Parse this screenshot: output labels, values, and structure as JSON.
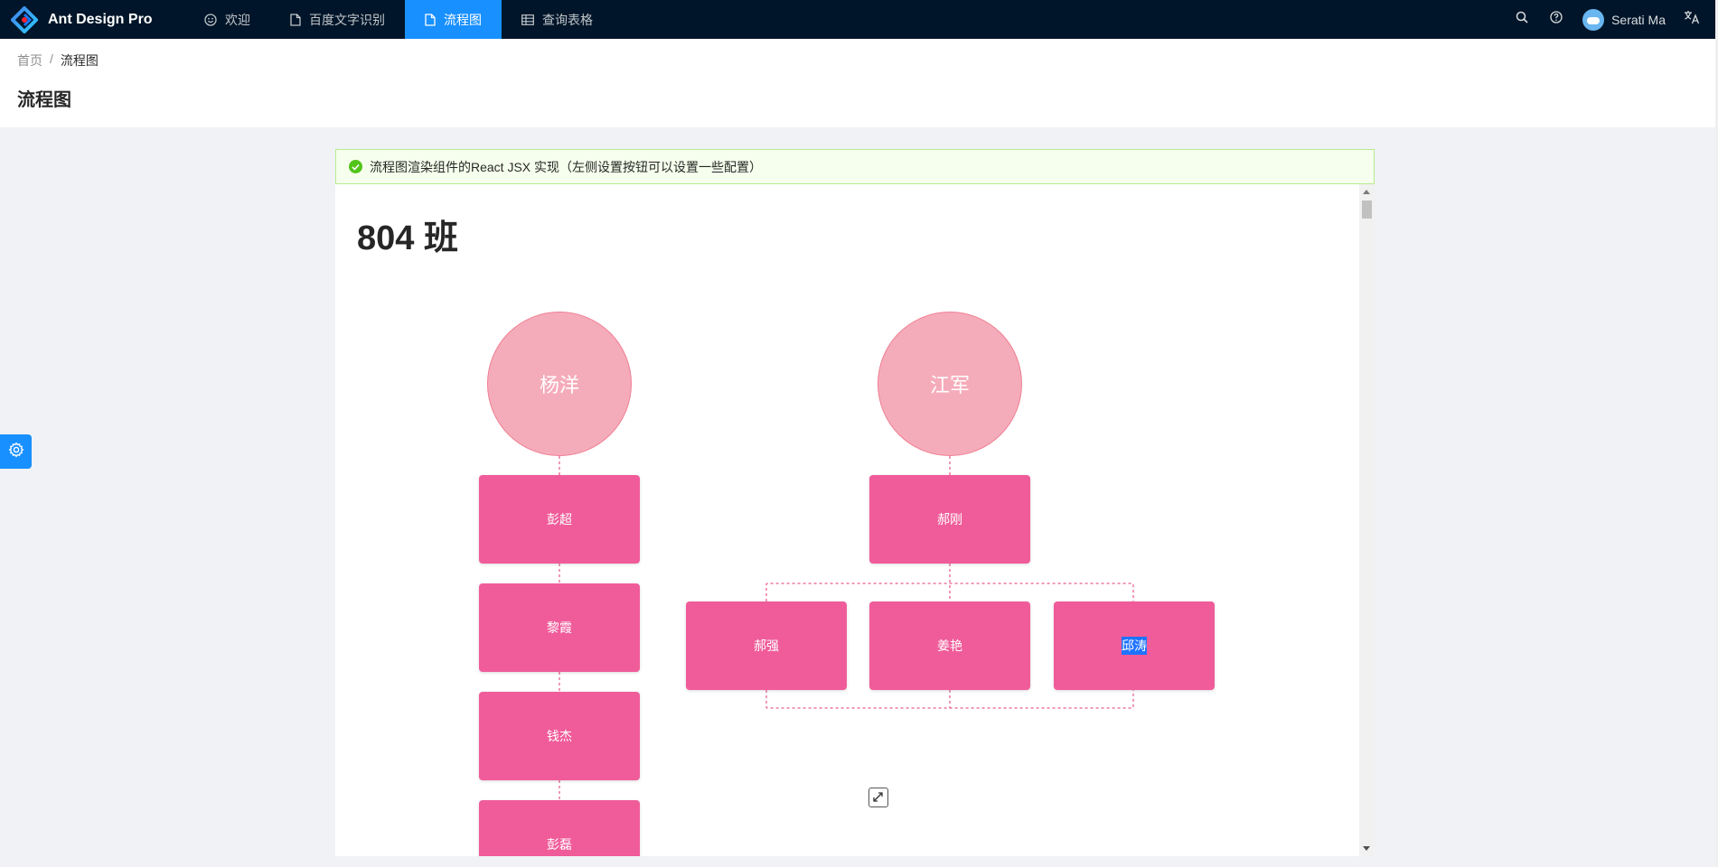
{
  "app": {
    "title": "Ant Design Pro"
  },
  "nav": [
    {
      "label": "欢迎",
      "icon": "smile-icon",
      "active": false
    },
    {
      "label": "百度文字识别",
      "icon": "file-icon",
      "active": false
    },
    {
      "label": "流程图",
      "icon": "file-icon",
      "active": true
    },
    {
      "label": "查询表格",
      "icon": "table-icon",
      "active": false
    }
  ],
  "header_right": {
    "user_name": "Serati Ma"
  },
  "breadcrumb": {
    "home": "首页",
    "separator": "/",
    "current": "流程图"
  },
  "page": {
    "title": "流程图"
  },
  "alert": {
    "message": "流程图渲染组件的React JSX 实现（左侧设置按钮可以设置一些配置）"
  },
  "flow": {
    "title": "804 班",
    "teachers": [
      {
        "name": "杨洋",
        "students": [
          "彭超",
          "黎霞",
          "钱杰",
          "彭磊"
        ]
      },
      {
        "name": "江军",
        "leader": "郝刚",
        "group": [
          "郝强",
          "姜艳",
          "邱涛"
        ]
      }
    ]
  },
  "colors": {
    "header_bg": "#001529",
    "primary": "#1890ff",
    "circle": "#f5acba",
    "node": "#f05c9a",
    "success": "#52c41a"
  }
}
